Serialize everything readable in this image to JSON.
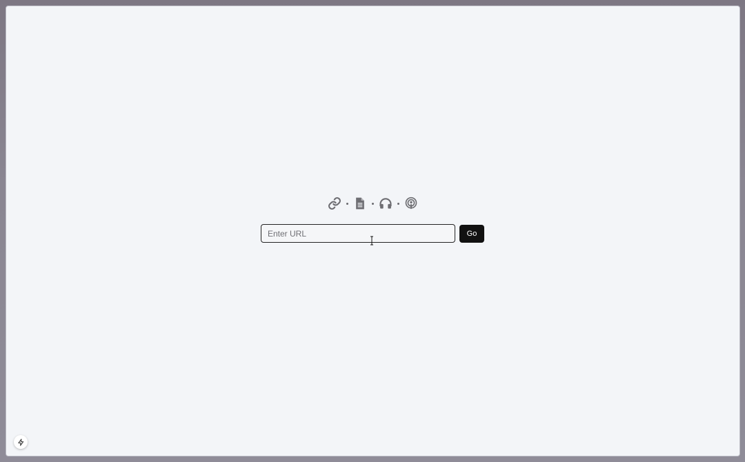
{
  "icons": [
    {
      "name": "link-icon"
    },
    {
      "name": "document-icon"
    },
    {
      "name": "headphones-icon"
    },
    {
      "name": "podcast-icon"
    }
  ],
  "url_form": {
    "placeholder": "Enter URL",
    "value": "",
    "go_label": "Go"
  },
  "colors": {
    "background": "#f3f5f8",
    "icon": "#6e6e73",
    "button": "#111111",
    "button_text": "#ffffff"
  }
}
